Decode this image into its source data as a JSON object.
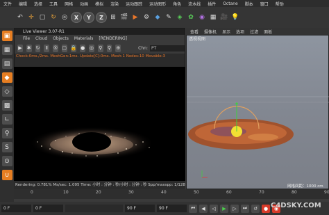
{
  "menu": [
    "文件",
    "编辑",
    "选择",
    "工具",
    "网格",
    "动画",
    "模拟",
    "渲染",
    "运动跟踪",
    "运动图形",
    "角色",
    "流水线",
    "插件",
    "Octane",
    "脚本",
    "窗口",
    "帮助"
  ],
  "toolbar": {
    "coord_x": "X",
    "coord_y": "Y",
    "coord_z": "Z"
  },
  "live_viewer": {
    "title": "Live Viewer 3.07-R1",
    "menus": [
      "File",
      "Cloud",
      "Objects",
      "Materials",
      "[RENDERING]"
    ],
    "chn_label": "Chn:",
    "chn_value": "PT",
    "status_text": "Check:0ms./2ms. MeshGen:1ms. Update[C]:0ms. Mesh:1 Nodes:10 Movable:3",
    "render_status": "Rendering: 0.781%  Ms/sec: 1.095   Time: 小时 : 分钟 : 秒/小时 : 分钟 : 秒   Spp/maxspp: 1/128"
  },
  "viewport": {
    "tabs": [
      "查看",
      "摄像机",
      "显示",
      "选项",
      "过滤",
      "面板"
    ],
    "label": "透视视图",
    "footer": "网格间距：1000 cm"
  },
  "timeline": {
    "ticks": [
      "0",
      "10",
      "20",
      "30",
      "40",
      "50",
      "60",
      "70",
      "80",
      "90"
    ]
  },
  "playback": {
    "start_frame": "0 F",
    "current_frame": "0 F",
    "end_frame": "90 F",
    "end_frame_2": "90 F"
  },
  "watermark": "C4DSKY.COM",
  "colors": {
    "accent": "#e8762a",
    "status_text": "#e8762a"
  }
}
